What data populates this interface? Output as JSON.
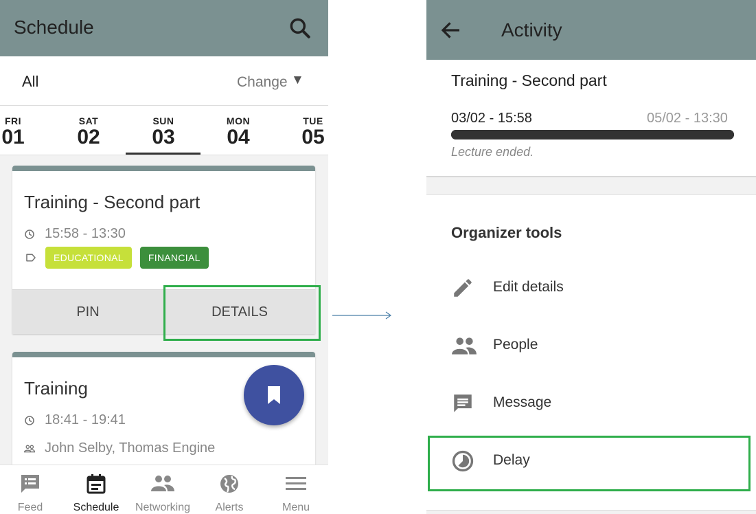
{
  "left": {
    "appbar": {
      "title": "Schedule"
    },
    "filter": {
      "value": "All",
      "change_label": "Change",
      "caret": "▼"
    },
    "days": [
      {
        "name": "FRI",
        "num": "01"
      },
      {
        "name": "SAT",
        "num": "02"
      },
      {
        "name": "SUN",
        "num": "03",
        "selected": true
      },
      {
        "name": "MON",
        "num": "04"
      },
      {
        "name": "TUE",
        "num": "05"
      }
    ],
    "cards": [
      {
        "title": "Training - Second part",
        "time": "15:58 - 13:30",
        "tags": [
          {
            "label": "EDUCATIONAL",
            "bg": "#c6e03a",
            "fg": "#ffffff"
          },
          {
            "label": "FINANCIAL",
            "bg": "#3c8f3c",
            "fg": "#ffffff"
          }
        ],
        "actions": {
          "pin": "PIN",
          "details": "DETAILS"
        }
      },
      {
        "title": "Training",
        "time": "18:41 - 19:41",
        "people": "John Selby, Thomas Engine"
      }
    ],
    "bottom_nav": [
      {
        "label": "Feed",
        "icon": "feed-icon"
      },
      {
        "label": "Schedule",
        "icon": "calendar-icon",
        "active": true
      },
      {
        "label": "Networking",
        "icon": "people-icon"
      },
      {
        "label": "Alerts",
        "icon": "globe-icon"
      },
      {
        "label": "Menu",
        "icon": "menu-icon"
      }
    ]
  },
  "right": {
    "appbar": {
      "title": "Activity"
    },
    "activity": {
      "title": "Training - Second part",
      "start": "03/02 - 15:58",
      "end": "05/02 - 13:30",
      "progress": 1.0,
      "status": "Lecture ended."
    },
    "tools": {
      "header": "Organizer tools",
      "items": [
        {
          "label": "Edit details",
          "icon": "pencil-icon"
        },
        {
          "label": "People",
          "icon": "people-icon"
        },
        {
          "label": "Message",
          "icon": "message-icon"
        },
        {
          "label": "Delay",
          "icon": "clock-icon"
        }
      ]
    }
  },
  "colors": {
    "appbar": "#7b9191",
    "highlight": "#2fae4b",
    "fab": "#3f51a0",
    "arrow": "#4a7fa8"
  }
}
